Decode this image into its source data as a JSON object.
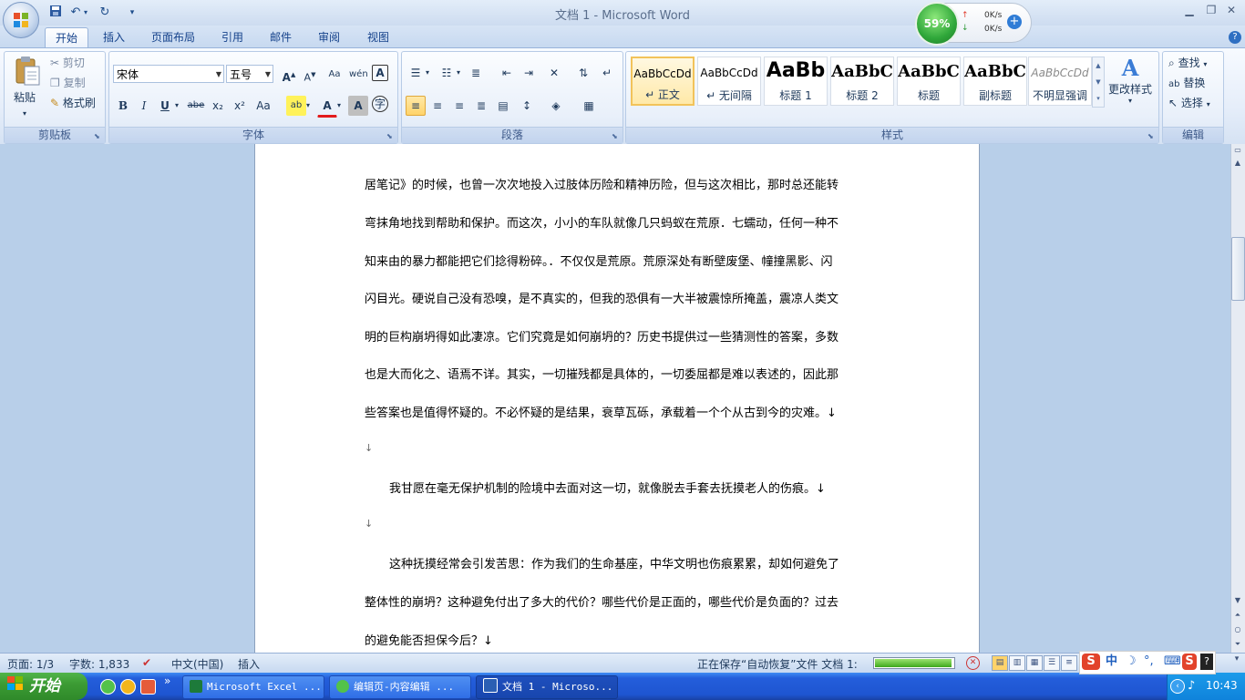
{
  "titlebar": {
    "title": "文档 1 - Microsoft Word",
    "qat": [
      "save-icon",
      "undo-icon",
      "redo-icon",
      "customize-icon"
    ],
    "controls": [
      "minimize",
      "restore",
      "close"
    ]
  },
  "network": {
    "cpu": "59%",
    "up": "0K/s",
    "down": "0K/s"
  },
  "tabs": [
    "开始",
    "插入",
    "页面布局",
    "引用",
    "邮件",
    "审阅",
    "视图"
  ],
  "active_tab": "开始",
  "ribbon": {
    "clipboard": {
      "label": "剪贴板",
      "paste": "粘贴",
      "cut": "剪切",
      "copy": "复制",
      "format_painter": "格式刷"
    },
    "font": {
      "label": "字体",
      "name": "宋体",
      "size": "五号",
      "buttons": [
        "B",
        "I",
        "U",
        "abe",
        "x₂",
        "x²",
        "Aa"
      ]
    },
    "paragraph": {
      "label": "段落"
    },
    "styles": {
      "label": "样式",
      "items": [
        {
          "sample": "AaBbCcDd",
          "name": "↵ 正文",
          "selected": true
        },
        {
          "sample": "AaBbCcDd",
          "name": "↵ 无间隔"
        },
        {
          "sample": "AaBb",
          "name": "标题 1"
        },
        {
          "sample": "AaBbC",
          "name": "标题 2"
        },
        {
          "sample": "AaBbC",
          "name": "标题"
        },
        {
          "sample": "AaBbC",
          "name": "副标题"
        },
        {
          "sample": "AaBbCcDd",
          "name": "不明显强调"
        }
      ],
      "change_styles": "更改样式"
    },
    "editing": {
      "label": "编辑",
      "find": "查找",
      "replace": "替换",
      "select": "选择"
    }
  },
  "document": {
    "lines": [
      "居笔记》的时候，也曾一次次地投入过肢体历险和精神历险，但与这次相比，那时总还能转",
      "弯抹角地找到帮助和保护。而这次，小小的车队就像几只蚂蚁在荒原．七蠕动，任何一种不",
      "知来由的暴力都能把它们捻得粉碎。．不仅仅是荒原。荒原深处有断壁废堡、幢撞黑影、闪",
      "闪目光。硬说自己没有恐嗅，是不真实的，但我的恐俱有一大半被震惊所掩盖，震凉人类文",
      "明的巨构崩坍得如此凄凉。它们究竟是如何崩坍的？历史书提供过一些猜测性的答案，多数",
      "也是大而化之、语焉不详。其实，一切摧残都是具体的，一切委屈都是难以表述的，因此那",
      "些答案也是值得怀疑的。不必怀疑的是结果，衰草瓦砾，承载着一个个从古到今的灾难。↓",
      "↓",
      "我甘愿在毫无保护机制的险境中去面对这一切，就像脱去手套去抚摸老人的伤痕。↓",
      "↓",
      "这种抚摸经常会引发苦思：作为我们的生命基座，中华文明也伤痕累累，却如何避免了",
      "整体性的崩坍？这种避免付出了多大的代价？哪些代价是正面的，哪些代价是负面的？过去",
      "的避免能否担保今后？↓"
    ]
  },
  "status": {
    "page": "页面: 1/3",
    "words": "字数: 1,833",
    "language": "中文(中国)",
    "mode": "插入",
    "saving": "正在保存“自动恢复”文件 文档 1:",
    "progress": 0.98
  },
  "ime": {
    "mode": "中"
  },
  "taskbar": {
    "start": "开始",
    "tasks": [
      "Microsoft Excel ...",
      "编辑页-内容编辑 ...",
      "文档 1 - Microso..."
    ],
    "clock": "10:43"
  },
  "colors": {
    "ribbon_text": "#15428b",
    "taskbar": "#245edb",
    "start": "#3c9c34"
  }
}
